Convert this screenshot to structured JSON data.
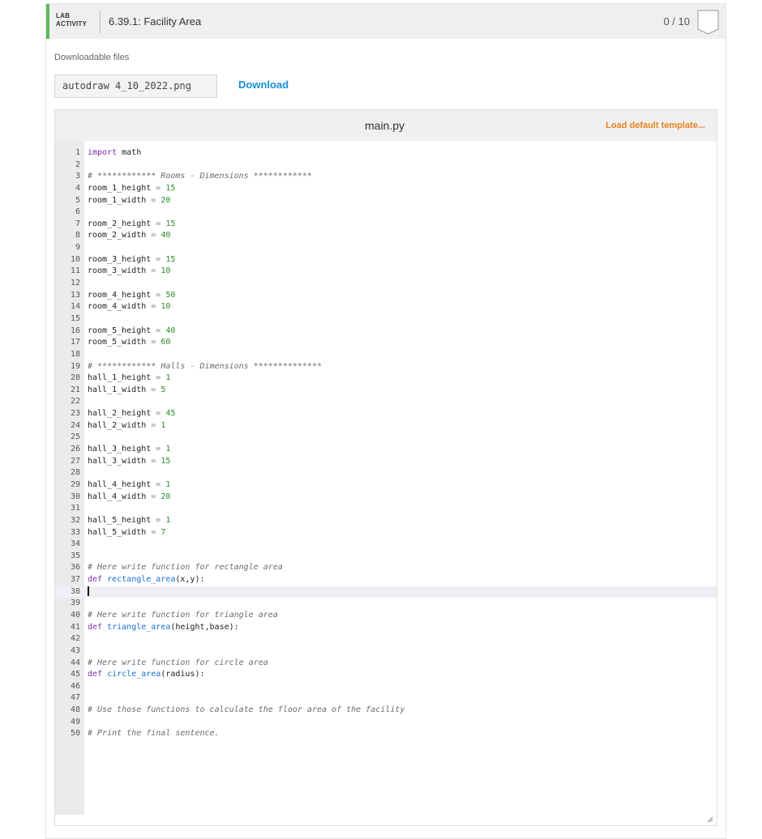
{
  "header": {
    "lab_line1": "LAB",
    "lab_line2": "ACTIVITY",
    "title": "6.39.1: Facility Area",
    "score": "0 / 10",
    "accent_color": "#5cb85c"
  },
  "downloads": {
    "label": "Downloadable files",
    "file_name": "autodraw 4_10_2022.png",
    "download_label": "Download"
  },
  "editor": {
    "file_name": "main.py",
    "load_template_label": "Load default template...",
    "active_line": 38,
    "code_lines": [
      "import math",
      "",
      "# ************ Rooms - Dimensions ************",
      "room_1_height = 15",
      "room_1_width = 20",
      "",
      "room_2_height = 15",
      "room_2_width = 40",
      "",
      "room_3_height = 15",
      "room_3_width = 10",
      "",
      "room_4_height = 50",
      "room_4_width = 10",
      "",
      "room_5_height = 40",
      "room_5_width = 60",
      "",
      "# ************ Halls - Dimensions **************",
      "hall_1_height = 1",
      "hall_1_width = 5",
      "",
      "hall_2_height = 45",
      "hall_2_width = 1",
      "",
      "hall_3_height = 1",
      "hall_3_width = 15",
      "",
      "hall_4_height = 1",
      "hall_4_width = 20",
      "",
      "hall_5_height = 1",
      "hall_5_width = 7",
      "",
      "",
      "# Here write function for rectangle area",
      "def rectangle_area(x,y):",
      "",
      "",
      "# Here write function for triangle area",
      "def triangle_area(height,base):",
      "",
      "",
      "# Here write function for circle area",
      "def circle_area(radius):",
      "",
      "",
      "# Use those functions to calculate the floor area of the facility",
      "",
      "# Print the final sentence."
    ]
  }
}
